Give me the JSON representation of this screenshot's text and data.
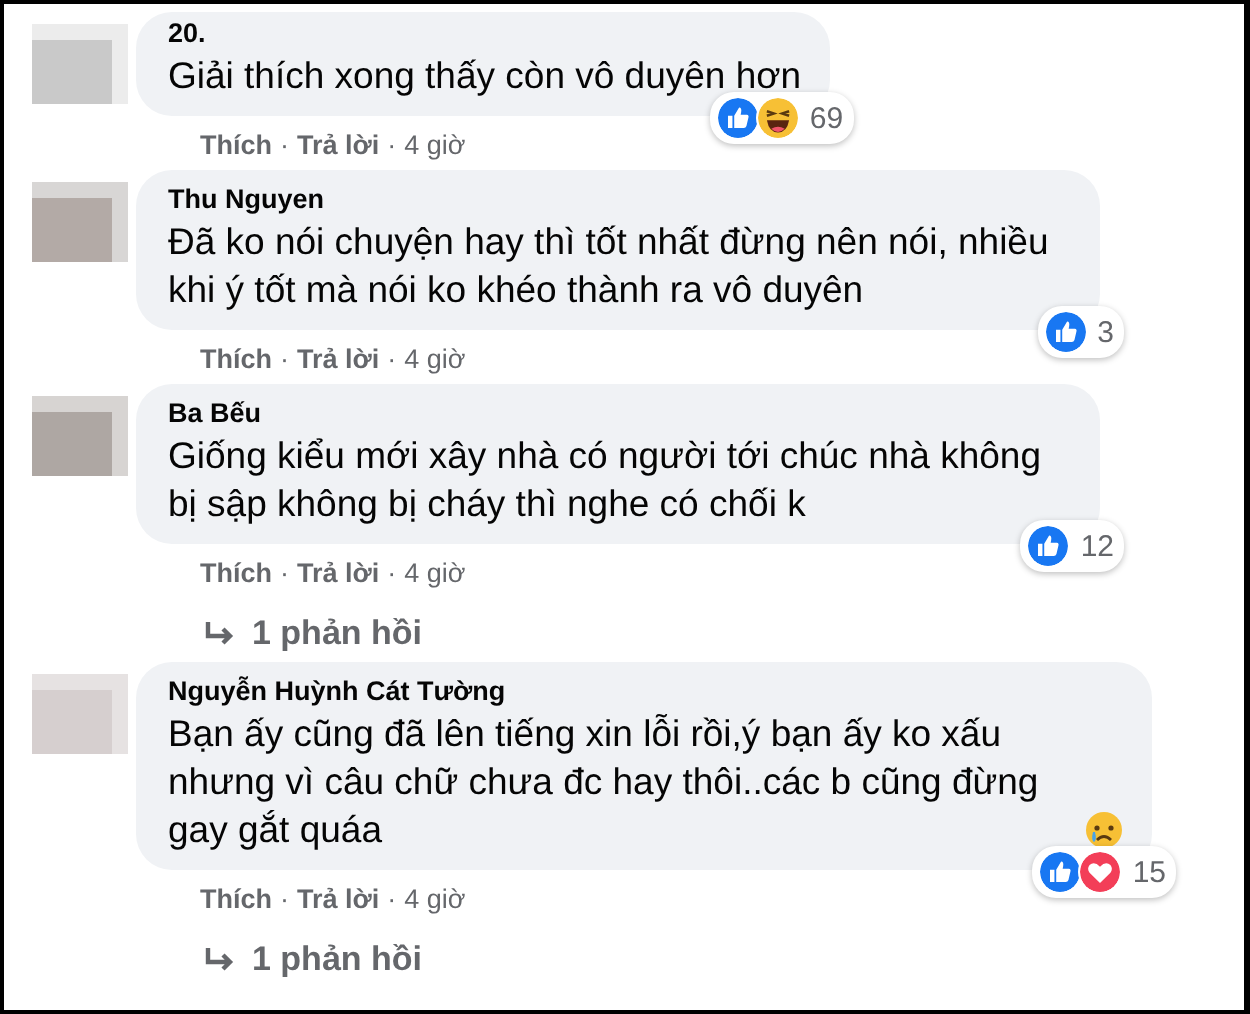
{
  "comments": [
    {
      "name": "20.",
      "text": "Giải thích xong thấy còn vô duyên hơn",
      "reactions": [
        {
          "kind": "like"
        },
        {
          "kind": "haha"
        }
      ],
      "count": "69",
      "actions": [
        {
          "kind": "link",
          "text": "Thích"
        },
        {
          "kind": "sep",
          "text": "·"
        },
        {
          "kind": "link",
          "text": "Trả lời"
        },
        {
          "kind": "sep",
          "text": "·"
        },
        {
          "kind": "time",
          "text": "4 giờ"
        }
      ]
    },
    {
      "name": "Thu Nguyen",
      "text": "Đã ko nói chuyện hay thì tốt nhất đừng nên nói, nhiều khi ý tốt mà nói ko khéo thành ra vô duyên",
      "reactions": [
        {
          "kind": "like"
        }
      ],
      "count": "3",
      "actions": [
        {
          "kind": "link",
          "text": "Thích"
        },
        {
          "kind": "sep",
          "text": "·"
        },
        {
          "kind": "link",
          "text": "Trả lời"
        },
        {
          "kind": "sep",
          "text": "·"
        },
        {
          "kind": "time",
          "text": "4 giờ"
        }
      ]
    },
    {
      "name": "Ba Bếu",
      "text": "Giống kiểu mới xây nhà có người tới chúc nhà không bị sập không bị cháy thì nghe có chối k",
      "reactions": [
        {
          "kind": "like"
        }
      ],
      "count": "12",
      "actions": [
        {
          "kind": "link",
          "text": "Thích"
        },
        {
          "kind": "sep",
          "text": "·"
        },
        {
          "kind": "link",
          "text": "Trả lời"
        },
        {
          "kind": "sep",
          "text": "·"
        },
        {
          "kind": "time",
          "text": "4 giờ"
        }
      ],
      "replies": "1 phản hồi"
    },
    {
      "name": "Nguyễn Huỳnh Cát Tường",
      "text": "Bạn ấy cũng đã lên tiếng xin lỗi rồi,ý bạn ấy ko xấu nhưng vì câu chữ chưa đc hay thôi..các b cũng đừng gay gắt quáa",
      "emoji": {
        "kind": "sad"
      },
      "reactions": [
        {
          "kind": "like"
        },
        {
          "kind": "love"
        }
      ],
      "count": "15",
      "actions": [
        {
          "kind": "link",
          "text": "Thích"
        },
        {
          "kind": "sep",
          "text": "·"
        },
        {
          "kind": "link",
          "text": "Trả lời"
        },
        {
          "kind": "sep",
          "text": "·"
        },
        {
          "kind": "time",
          "text": "4 giờ"
        }
      ],
      "replies": "1 phản hồi"
    }
  ]
}
